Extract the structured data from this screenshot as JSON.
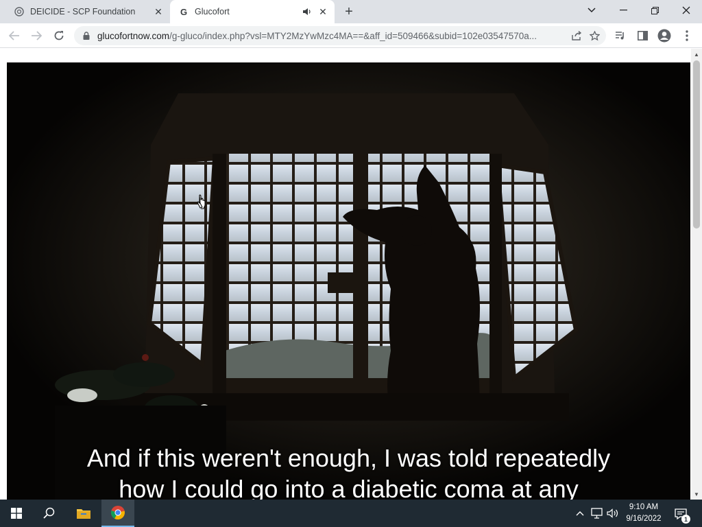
{
  "browser": {
    "tabs": [
      {
        "title": "DEICIDE - SCP Foundation",
        "favicon": "scp-logo-icon"
      },
      {
        "title": "Glucofort",
        "favicon": "google-g-icon",
        "audio": "speaker-icon"
      }
    ],
    "new_tab": "+",
    "window_controls": {
      "dropdown": "⌄",
      "minimize": "—",
      "restore": "❐",
      "close": "✕"
    },
    "address_bar": {
      "domain": "glucofortnow.com",
      "path": "/g-gluco/index.php?vsl=MTY2MzYwMzc4MA==&aff_id=509466&subid=102e03547570a..."
    }
  },
  "video": {
    "caption_line1": "And if this weren't enough, I was told repeatedly",
    "caption_line2": "how I could go into a diabetic coma at any"
  },
  "taskbar": {
    "time": "9:10 AM",
    "date": "9/16/2022",
    "notification_count": "1"
  },
  "colors": {
    "tabstrip": "#dee1e6",
    "taskbar": "#1f2a33",
    "video_bg": "#050403"
  }
}
